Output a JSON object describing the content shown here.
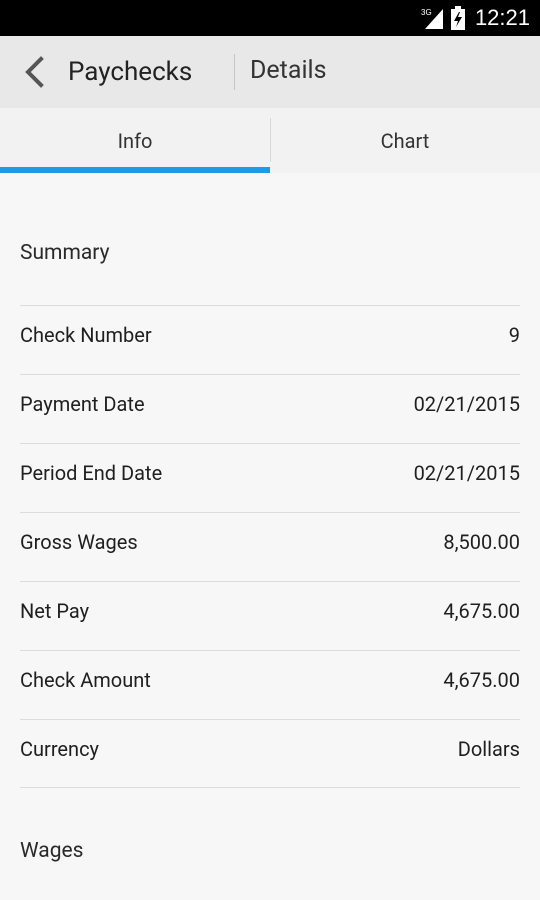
{
  "status_bar": {
    "network_label": "3G",
    "time": "12:21"
  },
  "action_bar": {
    "title": "Paychecks",
    "subtitle": "Details"
  },
  "tabs": [
    {
      "label": "Info",
      "selected": true
    },
    {
      "label": "Chart",
      "selected": false
    }
  ],
  "summary": {
    "header": "Summary",
    "rows": [
      {
        "label": "Check Number",
        "value": "9"
      },
      {
        "label": "Payment Date",
        "value": "02/21/2015"
      },
      {
        "label": "Period End Date",
        "value": "02/21/2015"
      },
      {
        "label": "Gross Wages",
        "value": "8,500.00"
      },
      {
        "label": "Net Pay",
        "value": "4,675.00"
      },
      {
        "label": "Check Amount",
        "value": "4,675.00"
      },
      {
        "label": "Currency",
        "value": "Dollars"
      }
    ]
  },
  "wages": {
    "header": "Wages"
  },
  "colors": {
    "accent": "#1e9be6",
    "action_bar_bg": "#e8e8e8",
    "background": "#f7f7f7"
  }
}
